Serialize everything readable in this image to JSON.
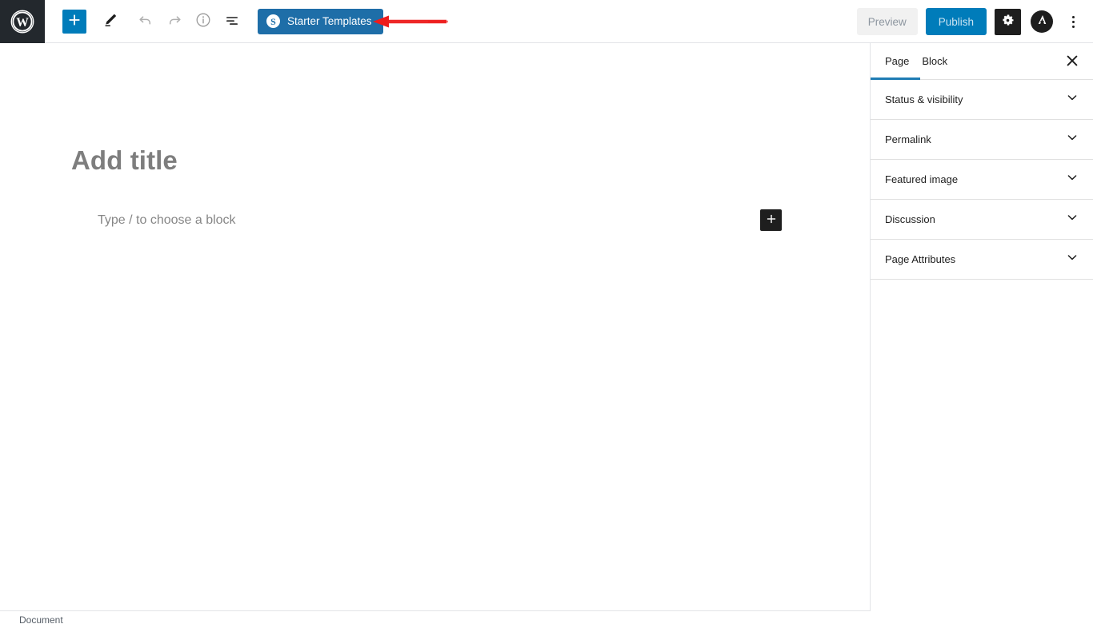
{
  "toolbar": {
    "wp_logo": "wordpress-logo",
    "add_block_label": "+",
    "icons": {
      "add_block": "plus-icon",
      "edit_tools": "pencil-icon",
      "undo": "undo-arrow-icon",
      "redo": "redo-arrow-icon",
      "details": "info-icon",
      "list_view": "list-view-icon"
    },
    "starter_templates": {
      "label": "Starter Templates",
      "icon_glyph": "S",
      "bg": "#1e6ea8"
    },
    "preview_label": "Preview",
    "publish_label": "Publish",
    "settings_icon": "gear-icon",
    "astra_icon": "astra-logo-icon",
    "astra_glyph": "A",
    "more_menu_icon": "kebab-menu-icon",
    "annotation": "red-left-arrow"
  },
  "editor": {
    "title_placeholder": "Add title",
    "block_placeholder": "Type / to choose a block",
    "inserter_label": "+"
  },
  "sidebar": {
    "tabs": [
      {
        "label": "Page",
        "active": true
      },
      {
        "label": "Block",
        "active": false
      }
    ],
    "close_icon": "close-icon",
    "panels": [
      {
        "label": "Status & visibility",
        "expanded": false
      },
      {
        "label": "Permalink",
        "expanded": false
      },
      {
        "label": "Featured image",
        "expanded": false
      },
      {
        "label": "Discussion",
        "expanded": false
      },
      {
        "label": "Page Attributes",
        "expanded": false
      }
    ]
  },
  "bottom_bar": {
    "breadcrumb": "Document"
  },
  "colors": {
    "accent_blue": "#007cba",
    "starter_blue": "#1e6ea8",
    "dark": "#1e1e1e",
    "wp_bar_dark": "#23282d",
    "annotation_red": "#ee1c1c"
  }
}
